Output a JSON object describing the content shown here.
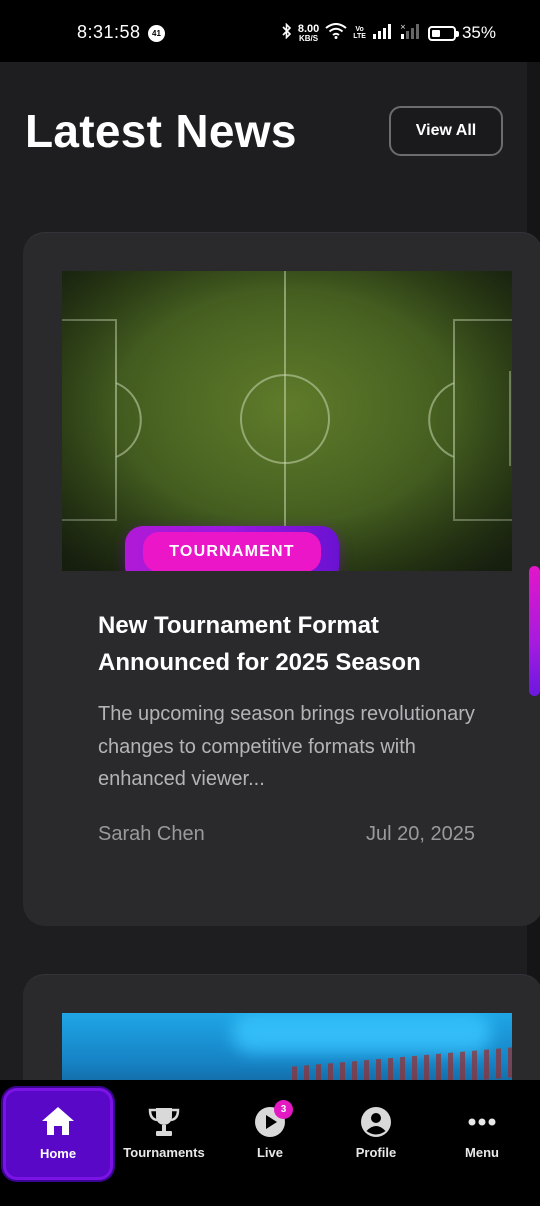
{
  "status_bar": {
    "time": "8:31:58",
    "notification_count": "41",
    "net_speed_value": "8.00",
    "net_speed_unit": "KB/S",
    "volte_top": "Vo",
    "volte_bottom": "LTE",
    "battery_percent": "35%",
    "battery_level": 0.35
  },
  "header": {
    "title": "Latest News",
    "view_all_label": "View All"
  },
  "articles": [
    {
      "image_icon": "soccer-field-image",
      "category": "TOURNAMENT",
      "title": "New Tournament Format Announced for 2025 Season",
      "excerpt": "The upcoming season brings revolutionary changes to competitive formats with enhanced viewer...",
      "author": "Sarah Chen",
      "date": "Jul 20, 2025"
    },
    {
      "image_icon": "gaming-setup-image"
    }
  ],
  "bottom_nav": {
    "items": [
      {
        "label": "Home",
        "icon": "home-icon",
        "active": true
      },
      {
        "label": "Tournaments",
        "icon": "trophy-icon"
      },
      {
        "label": "Live",
        "icon": "play-icon",
        "badge": "3"
      },
      {
        "label": "Profile",
        "icon": "user-icon"
      },
      {
        "label": "Menu",
        "icon": "more-icon"
      }
    ]
  },
  "colors": {
    "accent": "#e316c9",
    "accent_purple": "#6b18e0",
    "background": "#1e1e20",
    "card": "#2a2a2d"
  }
}
